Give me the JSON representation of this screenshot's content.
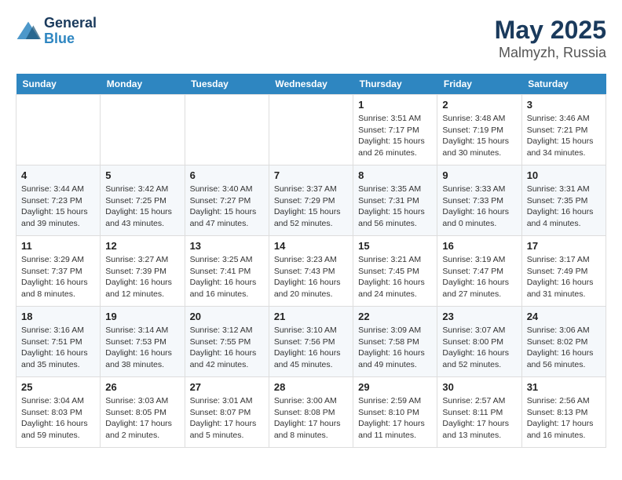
{
  "header": {
    "logo_line1": "General",
    "logo_line2": "Blue",
    "title": "May 2025",
    "subtitle": "Malmyzh, Russia"
  },
  "days_of_week": [
    "Sunday",
    "Monday",
    "Tuesday",
    "Wednesday",
    "Thursday",
    "Friday",
    "Saturday"
  ],
  "weeks": [
    [
      {
        "day": "",
        "detail": ""
      },
      {
        "day": "",
        "detail": ""
      },
      {
        "day": "",
        "detail": ""
      },
      {
        "day": "",
        "detail": ""
      },
      {
        "day": "1",
        "detail": "Sunrise: 3:51 AM\nSunset: 7:17 PM\nDaylight: 15 hours and 26 minutes."
      },
      {
        "day": "2",
        "detail": "Sunrise: 3:48 AM\nSunset: 7:19 PM\nDaylight: 15 hours and 30 minutes."
      },
      {
        "day": "3",
        "detail": "Sunrise: 3:46 AM\nSunset: 7:21 PM\nDaylight: 15 hours and 34 minutes."
      }
    ],
    [
      {
        "day": "4",
        "detail": "Sunrise: 3:44 AM\nSunset: 7:23 PM\nDaylight: 15 hours and 39 minutes."
      },
      {
        "day": "5",
        "detail": "Sunrise: 3:42 AM\nSunset: 7:25 PM\nDaylight: 15 hours and 43 minutes."
      },
      {
        "day": "6",
        "detail": "Sunrise: 3:40 AM\nSunset: 7:27 PM\nDaylight: 15 hours and 47 minutes."
      },
      {
        "day": "7",
        "detail": "Sunrise: 3:37 AM\nSunset: 7:29 PM\nDaylight: 15 hours and 52 minutes."
      },
      {
        "day": "8",
        "detail": "Sunrise: 3:35 AM\nSunset: 7:31 PM\nDaylight: 15 hours and 56 minutes."
      },
      {
        "day": "9",
        "detail": "Sunrise: 3:33 AM\nSunset: 7:33 PM\nDaylight: 16 hours and 0 minutes."
      },
      {
        "day": "10",
        "detail": "Sunrise: 3:31 AM\nSunset: 7:35 PM\nDaylight: 16 hours and 4 minutes."
      }
    ],
    [
      {
        "day": "11",
        "detail": "Sunrise: 3:29 AM\nSunset: 7:37 PM\nDaylight: 16 hours and 8 minutes."
      },
      {
        "day": "12",
        "detail": "Sunrise: 3:27 AM\nSunset: 7:39 PM\nDaylight: 16 hours and 12 minutes."
      },
      {
        "day": "13",
        "detail": "Sunrise: 3:25 AM\nSunset: 7:41 PM\nDaylight: 16 hours and 16 minutes."
      },
      {
        "day": "14",
        "detail": "Sunrise: 3:23 AM\nSunset: 7:43 PM\nDaylight: 16 hours and 20 minutes."
      },
      {
        "day": "15",
        "detail": "Sunrise: 3:21 AM\nSunset: 7:45 PM\nDaylight: 16 hours and 24 minutes."
      },
      {
        "day": "16",
        "detail": "Sunrise: 3:19 AM\nSunset: 7:47 PM\nDaylight: 16 hours and 27 minutes."
      },
      {
        "day": "17",
        "detail": "Sunrise: 3:17 AM\nSunset: 7:49 PM\nDaylight: 16 hours and 31 minutes."
      }
    ],
    [
      {
        "day": "18",
        "detail": "Sunrise: 3:16 AM\nSunset: 7:51 PM\nDaylight: 16 hours and 35 minutes."
      },
      {
        "day": "19",
        "detail": "Sunrise: 3:14 AM\nSunset: 7:53 PM\nDaylight: 16 hours and 38 minutes."
      },
      {
        "day": "20",
        "detail": "Sunrise: 3:12 AM\nSunset: 7:55 PM\nDaylight: 16 hours and 42 minutes."
      },
      {
        "day": "21",
        "detail": "Sunrise: 3:10 AM\nSunset: 7:56 PM\nDaylight: 16 hours and 45 minutes."
      },
      {
        "day": "22",
        "detail": "Sunrise: 3:09 AM\nSunset: 7:58 PM\nDaylight: 16 hours and 49 minutes."
      },
      {
        "day": "23",
        "detail": "Sunrise: 3:07 AM\nSunset: 8:00 PM\nDaylight: 16 hours and 52 minutes."
      },
      {
        "day": "24",
        "detail": "Sunrise: 3:06 AM\nSunset: 8:02 PM\nDaylight: 16 hours and 56 minutes."
      }
    ],
    [
      {
        "day": "25",
        "detail": "Sunrise: 3:04 AM\nSunset: 8:03 PM\nDaylight: 16 hours and 59 minutes."
      },
      {
        "day": "26",
        "detail": "Sunrise: 3:03 AM\nSunset: 8:05 PM\nDaylight: 17 hours and 2 minutes."
      },
      {
        "day": "27",
        "detail": "Sunrise: 3:01 AM\nSunset: 8:07 PM\nDaylight: 17 hours and 5 minutes."
      },
      {
        "day": "28",
        "detail": "Sunrise: 3:00 AM\nSunset: 8:08 PM\nDaylight: 17 hours and 8 minutes."
      },
      {
        "day": "29",
        "detail": "Sunrise: 2:59 AM\nSunset: 8:10 PM\nDaylight: 17 hours and 11 minutes."
      },
      {
        "day": "30",
        "detail": "Sunrise: 2:57 AM\nSunset: 8:11 PM\nDaylight: 17 hours and 13 minutes."
      },
      {
        "day": "31",
        "detail": "Sunrise: 2:56 AM\nSunset: 8:13 PM\nDaylight: 17 hours and 16 minutes."
      }
    ]
  ]
}
